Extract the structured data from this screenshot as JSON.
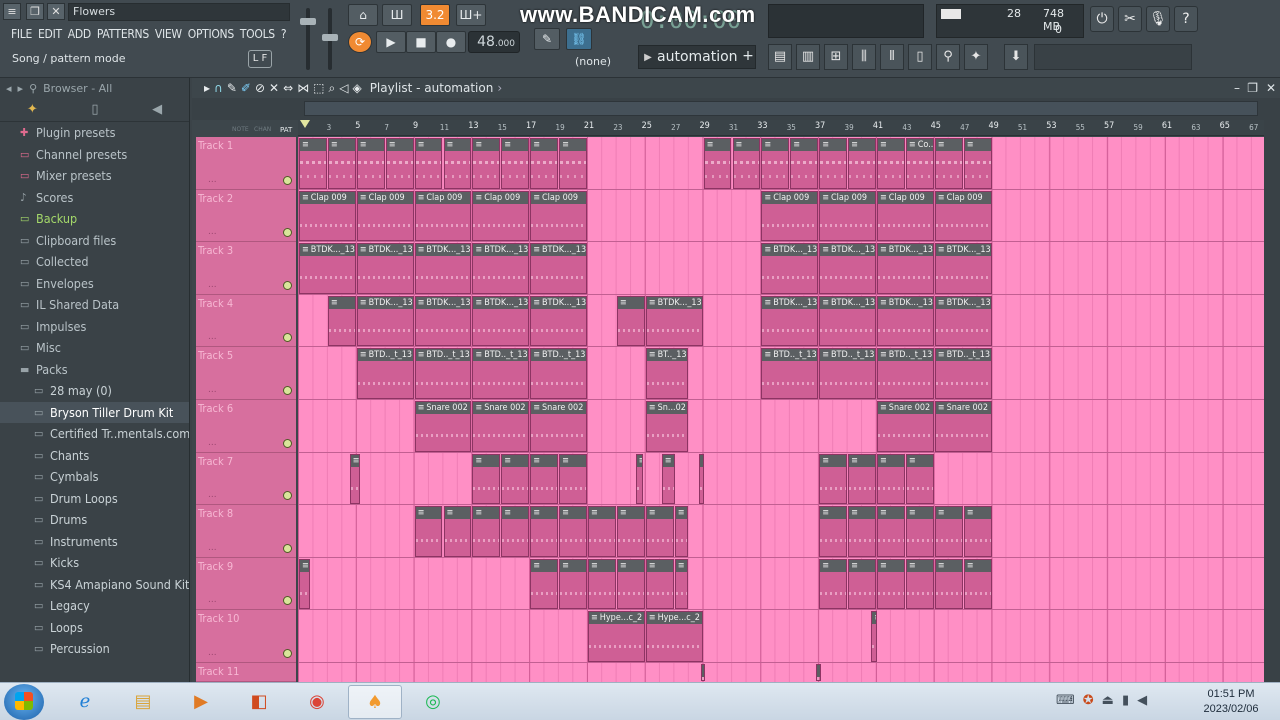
{
  "window": {
    "title": "Flowers",
    "mode": "Song / pattern mode",
    "mode_hint": "L F"
  },
  "menu": [
    "FILE",
    "EDIT",
    "ADD",
    "PATTERNS",
    "VIEW",
    "OPTIONS",
    "TOOLS",
    "?"
  ],
  "transport": {
    "pattern_number": "3.2",
    "tempo": "48",
    "tempo_decimal": ".000",
    "time": "0:00:00",
    "none_label": "(none)",
    "pattern_selector": "automation",
    "add_label": "+"
  },
  "watermark": "www.BANDICAM.com",
  "cpu": {
    "value": "28",
    "memory": "748 MB",
    "voices": "0"
  },
  "browser": {
    "header": "Browser - All",
    "items": [
      {
        "label": "Plugin presets",
        "icon": "plugin-icon",
        "depth": 0,
        "state": "pink"
      },
      {
        "label": "Channel presets",
        "icon": "folder-icon",
        "depth": 0,
        "state": "pink"
      },
      {
        "label": "Mixer presets",
        "icon": "folder-icon",
        "depth": 0,
        "state": "pink"
      },
      {
        "label": "Scores",
        "icon": "note-icon",
        "depth": 0,
        "state": ""
      },
      {
        "label": "Backup",
        "icon": "folder-icon",
        "depth": 0,
        "state": "backup"
      },
      {
        "label": "Clipboard files",
        "icon": "folder-icon",
        "depth": 0,
        "state": ""
      },
      {
        "label": "Collected",
        "icon": "folder-icon",
        "depth": 0,
        "state": ""
      },
      {
        "label": "Envelopes",
        "icon": "folder-icon",
        "depth": 0,
        "state": ""
      },
      {
        "label": "IL Shared Data",
        "icon": "folder-icon",
        "depth": 0,
        "state": ""
      },
      {
        "label": "Impulses",
        "icon": "folder-icon",
        "depth": 0,
        "state": ""
      },
      {
        "label": "Misc",
        "icon": "folder-icon",
        "depth": 0,
        "state": ""
      },
      {
        "label": "Packs",
        "icon": "folder-open-icon",
        "depth": 0,
        "state": ""
      },
      {
        "label": "28 may (0)",
        "icon": "folder-icon",
        "depth": 1,
        "state": ""
      },
      {
        "label": "Bryson Tiller Drum Kit",
        "icon": "folder-icon",
        "depth": 1,
        "state": "sel"
      },
      {
        "label": "Certified Tr..mentals.com)",
        "icon": "folder-icon",
        "depth": 1,
        "state": ""
      },
      {
        "label": "Chants",
        "icon": "folder-icon",
        "depth": 1,
        "state": ""
      },
      {
        "label": "Cymbals",
        "icon": "folder-icon",
        "depth": 1,
        "state": ""
      },
      {
        "label": "Drum Loops",
        "icon": "folder-icon",
        "depth": 1,
        "state": ""
      },
      {
        "label": "Drums",
        "icon": "folder-icon",
        "depth": 1,
        "state": ""
      },
      {
        "label": "Instruments",
        "icon": "folder-icon",
        "depth": 1,
        "state": ""
      },
      {
        "label": "Kicks",
        "icon": "folder-icon",
        "depth": 1,
        "state": ""
      },
      {
        "label": "KS4 Amapiano Sound Kit",
        "icon": "folder-icon",
        "depth": 1,
        "state": ""
      },
      {
        "label": "Legacy",
        "icon": "folder-icon",
        "depth": 1,
        "state": ""
      },
      {
        "label": "Loops",
        "icon": "folder-icon",
        "depth": 1,
        "state": ""
      },
      {
        "label": "Percussion",
        "icon": "folder-icon",
        "depth": 1,
        "state": ""
      }
    ]
  },
  "playlist": {
    "title": "Playlist - automation",
    "ruler_left": [
      "NOTE",
      "CHAN",
      "PAT"
    ],
    "bar_numbers": [
      3,
      5,
      7,
      9,
      11,
      13,
      15,
      17,
      19,
      21,
      23,
      25,
      27,
      29,
      31,
      33,
      35,
      37,
      39,
      41,
      43,
      45,
      47,
      49,
      51,
      53,
      55,
      57,
      59,
      61,
      63,
      65,
      67
    ],
    "tracks": [
      {
        "name": "Track 1",
        "clips": [
          {
            "start": 1,
            "len": 2,
            "label": ""
          },
          {
            "start": 3,
            "len": 2,
            "label": ""
          },
          {
            "start": 5,
            "len": 2,
            "label": ""
          },
          {
            "start": 7,
            "len": 2,
            "label": ""
          },
          {
            "start": 9,
            "len": 2,
            "label": ""
          },
          {
            "start": 11,
            "len": 2,
            "label": ""
          },
          {
            "start": 13,
            "len": 2,
            "label": ""
          },
          {
            "start": 15,
            "len": 2,
            "label": ""
          },
          {
            "start": 17,
            "len": 2,
            "label": ""
          },
          {
            "start": 19,
            "len": 2,
            "label": ""
          },
          {
            "start": 29,
            "len": 2,
            "label": ""
          },
          {
            "start": 31,
            "len": 2,
            "label": ""
          },
          {
            "start": 33,
            "len": 2,
            "label": ""
          },
          {
            "start": 35,
            "len": 2,
            "label": ""
          },
          {
            "start": 37,
            "len": 2,
            "label": ""
          },
          {
            "start": 39,
            "len": 2,
            "label": ""
          },
          {
            "start": 41,
            "len": 2,
            "label": ""
          },
          {
            "start": 43,
            "len": 2,
            "label": "Co.."
          },
          {
            "start": 45,
            "len": 2,
            "label": ""
          },
          {
            "start": 47,
            "len": 2,
            "label": ""
          }
        ]
      },
      {
        "name": "Track 2",
        "clips": [
          {
            "start": 1,
            "len": 4,
            "label": "Clap 009"
          },
          {
            "start": 5,
            "len": 4,
            "label": "Clap 009"
          },
          {
            "start": 9,
            "len": 4,
            "label": "Clap 009"
          },
          {
            "start": 13,
            "len": 4,
            "label": "Clap 009"
          },
          {
            "start": 17,
            "len": 4,
            "label": "Clap 009"
          },
          {
            "start": 33,
            "len": 4,
            "label": "Clap 009"
          },
          {
            "start": 37,
            "len": 4,
            "label": "Clap 009"
          },
          {
            "start": 41,
            "len": 4,
            "label": "Clap 009"
          },
          {
            "start": 45,
            "len": 4,
            "label": "Clap 009"
          }
        ]
      },
      {
        "name": "Track 3",
        "clips": [
          {
            "start": 1,
            "len": 4,
            "label": "BTDK..._13"
          },
          {
            "start": 5,
            "len": 4,
            "label": "BTDK..._13"
          },
          {
            "start": 9,
            "len": 4,
            "label": "BTDK..._13"
          },
          {
            "start": 13,
            "len": 4,
            "label": "BTDK..._13"
          },
          {
            "start": 17,
            "len": 4,
            "label": "BTDK..._13"
          },
          {
            "start": 33,
            "len": 4,
            "label": "BTDK..._13"
          },
          {
            "start": 37,
            "len": 4,
            "label": "BTDK..._13"
          },
          {
            "start": 41,
            "len": 4,
            "label": "BTDK..._13"
          },
          {
            "start": 45,
            "len": 4,
            "label": "BTDK..._13"
          }
        ]
      },
      {
        "name": "Track 4",
        "clips": [
          {
            "start": 3,
            "len": 2,
            "label": ""
          },
          {
            "start": 5,
            "len": 4,
            "label": "BTDK..._13"
          },
          {
            "start": 9,
            "len": 4,
            "label": "BTDK..._13"
          },
          {
            "start": 13,
            "len": 4,
            "label": "BTDK..._13"
          },
          {
            "start": 17,
            "len": 4,
            "label": "BTDK..._13"
          },
          {
            "start": 23,
            "len": 2,
            "label": ""
          },
          {
            "start": 25,
            "len": 4,
            "label": "BTDK..._13"
          },
          {
            "start": 33,
            "len": 4,
            "label": "BTDK..._13"
          },
          {
            "start": 37,
            "len": 4,
            "label": "BTDK..._13"
          },
          {
            "start": 41,
            "len": 4,
            "label": "BTDK..._13"
          },
          {
            "start": 45,
            "len": 4,
            "label": "BTDK..._13"
          }
        ]
      },
      {
        "name": "Track 5",
        "clips": [
          {
            "start": 5,
            "len": 4,
            "label": "BTD.._t_13"
          },
          {
            "start": 9,
            "len": 4,
            "label": "BTD.._t_13"
          },
          {
            "start": 13,
            "len": 4,
            "label": "BTD.._t_13"
          },
          {
            "start": 17,
            "len": 4,
            "label": "BTD.._t_13"
          },
          {
            "start": 25,
            "len": 3,
            "label": "BT.._13"
          },
          {
            "start": 33,
            "len": 4,
            "label": "BTD.._t_13"
          },
          {
            "start": 37,
            "len": 4,
            "label": "BTD.._t_13"
          },
          {
            "start": 41,
            "len": 4,
            "label": "BTD.._t_13"
          },
          {
            "start": 45,
            "len": 4,
            "label": "BTD.._t_13"
          }
        ]
      },
      {
        "name": "Track 6",
        "clips": [
          {
            "start": 9,
            "len": 4,
            "label": "Snare 002"
          },
          {
            "start": 13,
            "len": 4,
            "label": "Snare 002"
          },
          {
            "start": 17,
            "len": 4,
            "label": "Snare 002"
          },
          {
            "start": 25,
            "len": 3,
            "label": "Sn...02"
          },
          {
            "start": 41,
            "len": 4,
            "label": "Snare 002"
          },
          {
            "start": 45,
            "len": 4,
            "label": "Snare 002"
          }
        ]
      },
      {
        "name": "Track 7",
        "clips": [
          {
            "start": 4.5,
            "len": 0.8,
            "label": ""
          },
          {
            "start": 13,
            "len": 2,
            "label": ""
          },
          {
            "start": 15,
            "len": 2,
            "label": ""
          },
          {
            "start": 17,
            "len": 2,
            "label": ""
          },
          {
            "start": 19,
            "len": 2,
            "label": ""
          },
          {
            "start": 24.3,
            "len": 0.6,
            "label": ""
          },
          {
            "start": 26.1,
            "len": 1,
            "label": ""
          },
          {
            "start": 28.7,
            "len": 0.4,
            "label": ""
          },
          {
            "start": 37,
            "len": 2,
            "label": ""
          },
          {
            "start": 39,
            "len": 2,
            "label": ""
          },
          {
            "start": 41,
            "len": 2,
            "label": ""
          },
          {
            "start": 43,
            "len": 2,
            "label": ""
          }
        ]
      },
      {
        "name": "Track 8",
        "clips": [
          {
            "start": 9,
            "len": 2,
            "label": ""
          },
          {
            "start": 11,
            "len": 2,
            "label": ""
          },
          {
            "start": 13,
            "len": 2,
            "label": ""
          },
          {
            "start": 15,
            "len": 2,
            "label": ""
          },
          {
            "start": 17,
            "len": 2,
            "label": ""
          },
          {
            "start": 19,
            "len": 2,
            "label": ""
          },
          {
            "start": 21,
            "len": 2,
            "label": ""
          },
          {
            "start": 23,
            "len": 2,
            "label": ""
          },
          {
            "start": 25,
            "len": 2,
            "label": ""
          },
          {
            "start": 27,
            "len": 1,
            "label": ""
          },
          {
            "start": 37,
            "len": 2,
            "label": ""
          },
          {
            "start": 39,
            "len": 2,
            "label": ""
          },
          {
            "start": 41,
            "len": 2,
            "label": ""
          },
          {
            "start": 43,
            "len": 2,
            "label": ""
          },
          {
            "start": 45,
            "len": 2,
            "label": ""
          },
          {
            "start": 47,
            "len": 2,
            "label": ""
          }
        ]
      },
      {
        "name": "Track 9",
        "clips": [
          {
            "start": 1,
            "len": 0.8,
            "label": ""
          },
          {
            "start": 17,
            "len": 2,
            "label": ""
          },
          {
            "start": 19,
            "len": 2,
            "label": ""
          },
          {
            "start": 21,
            "len": 2,
            "label": ""
          },
          {
            "start": 23,
            "len": 2,
            "label": ""
          },
          {
            "start": 25,
            "len": 2,
            "label": ""
          },
          {
            "start": 27,
            "len": 1,
            "label": ""
          },
          {
            "start": 37,
            "len": 2,
            "label": ""
          },
          {
            "start": 39,
            "len": 2,
            "label": ""
          },
          {
            "start": 41,
            "len": 2,
            "label": ""
          },
          {
            "start": 43,
            "len": 2,
            "label": ""
          },
          {
            "start": 45,
            "len": 2,
            "label": ""
          },
          {
            "start": 47,
            "len": 2,
            "label": ""
          }
        ]
      },
      {
        "name": "Track 10",
        "clips": [
          {
            "start": 21,
            "len": 4,
            "label": "Hype...c_2"
          },
          {
            "start": 25,
            "len": 4,
            "label": "Hype...c_2"
          },
          {
            "start": 40.6,
            "len": 0.5,
            "label": ""
          }
        ]
      },
      {
        "name": "Track 11",
        "clips": [
          {
            "start": 28.8,
            "len": 0.4,
            "label": ""
          },
          {
            "start": 36.8,
            "len": 0.4,
            "label": ""
          }
        ]
      }
    ]
  },
  "taskbar": {
    "apps": [
      "ie-icon",
      "explorer-icon",
      "media-icon",
      "office-icon",
      "chrome-icon",
      "flstudio-icon",
      "spotify-icon"
    ],
    "time": "01:51 PM",
    "date": "2023/02/06"
  }
}
